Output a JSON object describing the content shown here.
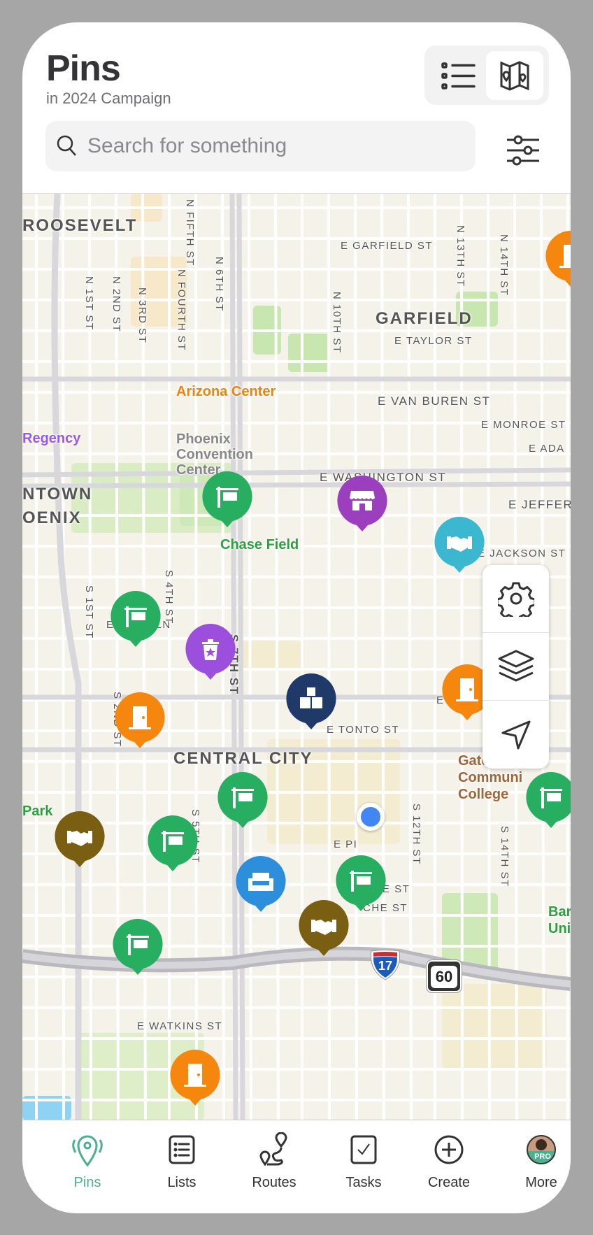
{
  "header": {
    "title": "Pins",
    "subtitle": "in 2024 Campaign",
    "view_toggle": {
      "list_icon": "list-icon",
      "map_icon": "map-icon",
      "active": "map"
    }
  },
  "search": {
    "placeholder": "Search for something",
    "value": "",
    "icon": "search-icon"
  },
  "filter": {
    "icon": "sliders-icon"
  },
  "map": {
    "labels": {
      "roosevelt": "ROOSEVELT",
      "garfield_st": "E GARFIELD ST",
      "garfield": "GARFIELD",
      "taylor": "E TAYLOR ST",
      "arizona_center": "Arizona Center",
      "van_buren": "E VAN BUREN ST",
      "monroe": "E MONROE ST",
      "adams": "E ADA",
      "regency": "Regency",
      "convention": "Phoenix Convention Center",
      "washington": "E WASHINGTON ST",
      "jefferson": "E JEFFER",
      "downtown1": "NTOWN",
      "downtown2": "OENIX",
      "chase": "Chase Field",
      "jackson": "E JACKSON ST",
      "lincoln": "E LINCOLN",
      "hadley": "E HADL",
      "tonto": "E TONTO ST",
      "central_city": "CENTRAL CITY",
      "gateway1": "Gateway",
      "gateway2": "Communi",
      "gateway3": "College",
      "park": "Park",
      "pi": "E PI",
      "ave": "AVE ST",
      "che": "CHE ST",
      "watkins": "E WATKINS ST",
      "bar1": "Bar",
      "bar2": "Uni",
      "n_fifth": "N FIFTH ST",
      "n_6th": "N 6TH ST",
      "n_fourth": "N FOURTH ST",
      "n_1st": "N 1ST ST",
      "n_2nd": "N 2ND ST",
      "n_3rd": "N 3RD ST",
      "n_10th": "N 10TH ST",
      "n_13th": "N 13TH ST",
      "n_14th": "N 14TH ST",
      "s_4th": "S 4TH ST",
      "s_1st": "S 1ST ST",
      "s_7th": "S 7TH ST",
      "s_2nd": "S 2ND ST",
      "s_5th": "S 5TH ST",
      "s_12th": "S 12TH ST",
      "s_14th": "S 14TH ST"
    },
    "shields": {
      "interstate": "17",
      "us_route": "60"
    },
    "pins": [
      {
        "type": "sign",
        "color": "#27ae60"
      },
      {
        "type": "store",
        "color": "#9b3fbf"
      },
      {
        "type": "handshake",
        "color": "#3bb8d0"
      },
      {
        "type": "sign",
        "color": "#27ae60"
      },
      {
        "type": "trash",
        "color": "#9b4fdc"
      },
      {
        "type": "boxes",
        "color": "#1f3a68"
      },
      {
        "type": "door",
        "color": "#f5870f"
      },
      {
        "type": "door",
        "color": "#f5870f"
      },
      {
        "type": "sign",
        "color": "#27ae60"
      },
      {
        "type": "sign",
        "color": "#27ae60"
      },
      {
        "type": "handshake",
        "color": "#7a5f12"
      },
      {
        "type": "sign",
        "color": "#27ae60"
      },
      {
        "type": "sofa",
        "color": "#2d8fdb"
      },
      {
        "type": "sign",
        "color": "#27ae60"
      },
      {
        "type": "handshake",
        "color": "#7a5f12"
      },
      {
        "type": "sign",
        "color": "#27ae60"
      },
      {
        "type": "door",
        "color": "#f5870f"
      },
      {
        "type": "door",
        "color": "#f5870f"
      }
    ],
    "controls": [
      {
        "icon": "gear-icon"
      },
      {
        "icon": "layers-icon"
      },
      {
        "icon": "location-arrow-icon"
      }
    ]
  },
  "nav": {
    "items": [
      {
        "label": "Pins",
        "icon": "pin-icon",
        "active": true
      },
      {
        "label": "Lists",
        "icon": "list-icon"
      },
      {
        "label": "Routes",
        "icon": "route-icon"
      },
      {
        "label": "Tasks",
        "icon": "checkbox-icon"
      },
      {
        "label": "Create",
        "icon": "plus-circle-icon"
      },
      {
        "label": "More",
        "icon": "avatar",
        "badge": "PRO"
      }
    ],
    "accent": "#4caf8f"
  }
}
